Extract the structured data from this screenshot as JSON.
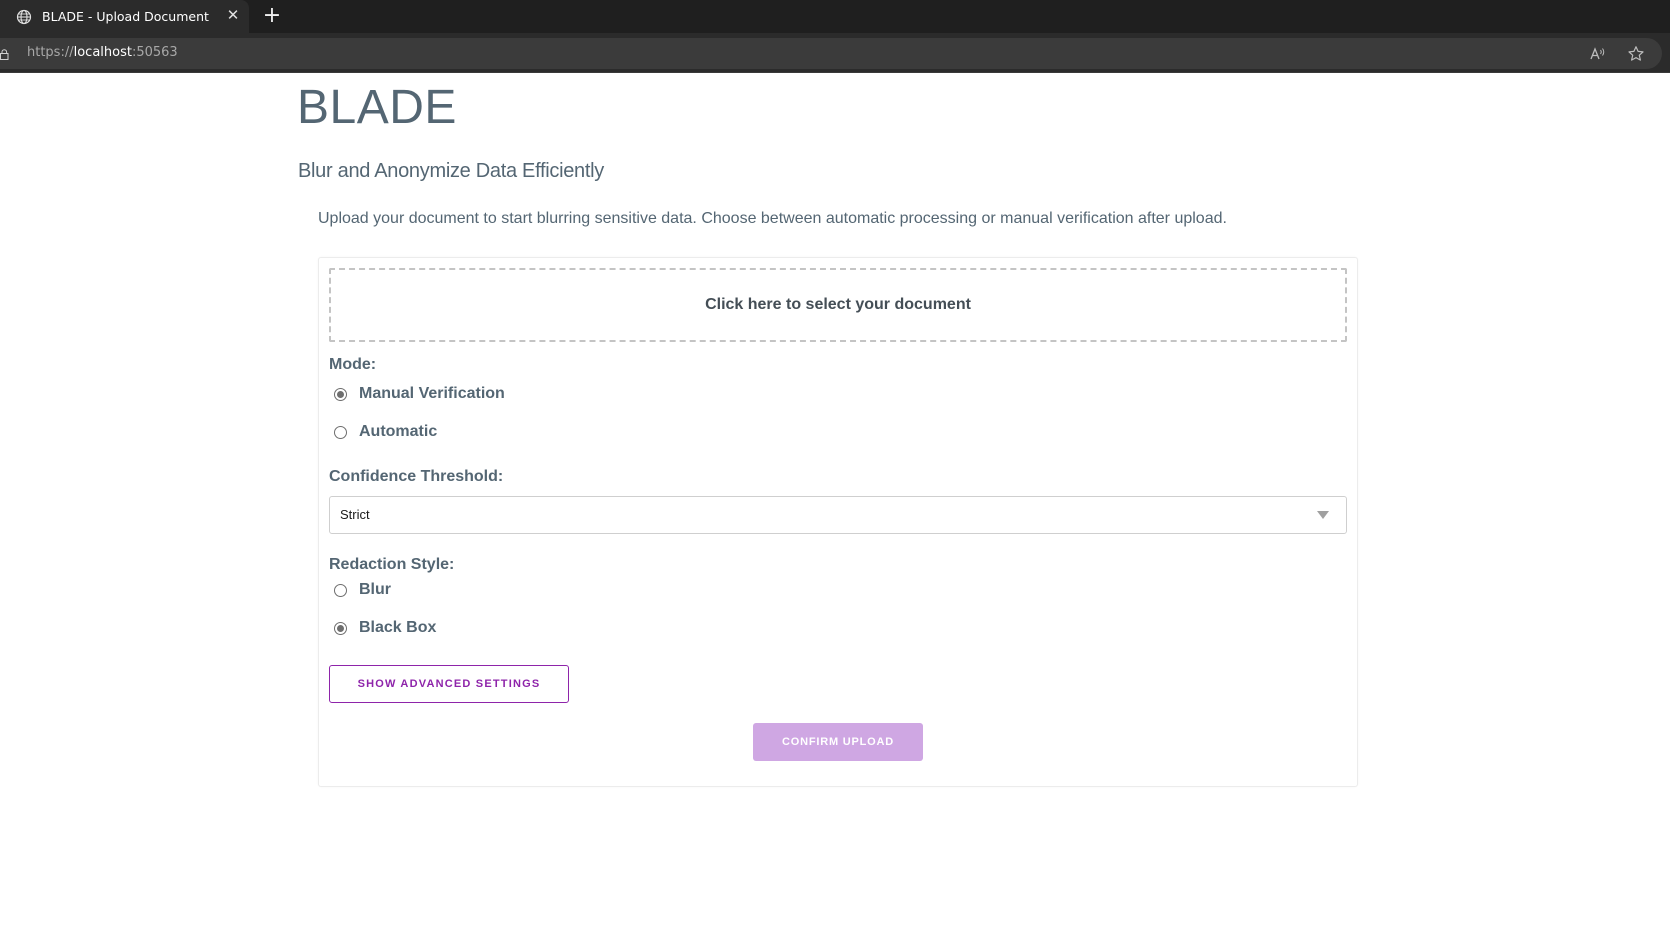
{
  "browser": {
    "tab_title": "BLADE - Upload Document",
    "url_scheme": "https://",
    "url_host": "localhost",
    "url_port": ":50563",
    "icons": {
      "tab": "globe-icon",
      "close": "close-icon",
      "new_tab": "plus-icon",
      "lock": "lock-icon",
      "read_aloud": "read-aloud-icon",
      "favorite": "star-icon"
    },
    "close_glyph": "✕",
    "new_tab_glyph": "+"
  },
  "page": {
    "title": "BLADE",
    "subtitle": "Blur and Anonymize Data Efficiently",
    "intro": "Upload your document to start blurring sensitive data. Choose between automatic processing or manual verification after upload.",
    "upload": {
      "dropzone_label": "Click here to select your document"
    },
    "mode": {
      "label": "Mode:",
      "options": [
        {
          "label": "Manual Verification",
          "checked": true
        },
        {
          "label": "Automatic",
          "checked": false
        }
      ]
    },
    "confidence": {
      "label": "Confidence Threshold:",
      "selected": "Strict"
    },
    "redaction": {
      "label": "Redaction Style:",
      "options": [
        {
          "label": "Blur",
          "checked": false
        },
        {
          "label": "Black Box",
          "checked": true
        }
      ]
    },
    "advanced_button": "SHOW ADVANCED SETTINGS",
    "confirm_button": "CONFIRM UPLOAD"
  },
  "colors": {
    "accent": "#8e24aa",
    "confirm_disabled": "#cfa7e3",
    "text": "#546673"
  }
}
